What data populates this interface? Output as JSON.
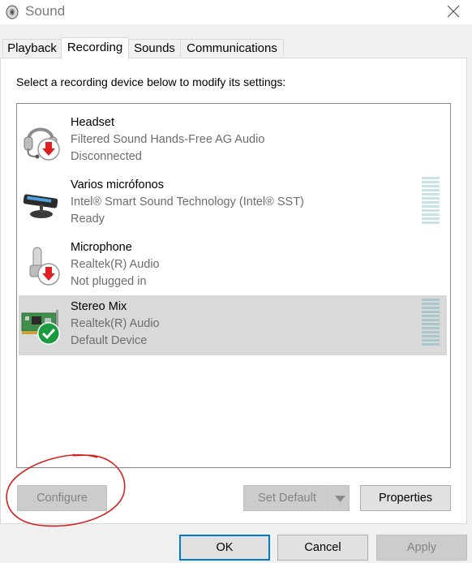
{
  "window": {
    "title": "Sound"
  },
  "tabs": [
    {
      "label": "Playback",
      "active": false
    },
    {
      "label": "Recording",
      "active": true
    },
    {
      "label": "Sounds",
      "active": false
    },
    {
      "label": "Communications",
      "active": false
    }
  ],
  "instructions": "Select a recording device below to modify its settings:",
  "devices": [
    {
      "name": "Headset",
      "driver": "Filtered Sound Hands-Free AG Audio",
      "status": "Disconnected",
      "icon": "headset-icon",
      "badge": "disconnected-arrow-icon",
      "selected": false,
      "level_meter": false
    },
    {
      "name": "Varios micrófonos",
      "driver": "Intel® Smart Sound Technology (Intel® SST)",
      "status": "Ready",
      "icon": "microphone-array-icon",
      "badge": "",
      "selected": false,
      "level_meter": true
    },
    {
      "name": "Microphone",
      "driver": "Realtek(R) Audio",
      "status": "Not plugged in",
      "icon": "microphone-icon",
      "badge": "disconnected-arrow-icon",
      "selected": false,
      "level_meter": false
    },
    {
      "name": "Stereo Mix",
      "driver": "Realtek(R) Audio",
      "status": "Default Device",
      "icon": "sound-card-icon",
      "badge": "default-checkmark-icon",
      "selected": true,
      "level_meter": true
    }
  ],
  "buttons": {
    "configure": "Configure",
    "set_default": "Set Default",
    "properties": "Properties",
    "ok": "OK",
    "cancel": "Cancel",
    "apply": "Apply"
  },
  "colors": {
    "selected_row": "#d9d9d9",
    "default_badge": "#1a9b3f",
    "disconnected_badge": "#e02020",
    "focus_border": "#0078d7",
    "annotation_circle": "#d92020"
  }
}
